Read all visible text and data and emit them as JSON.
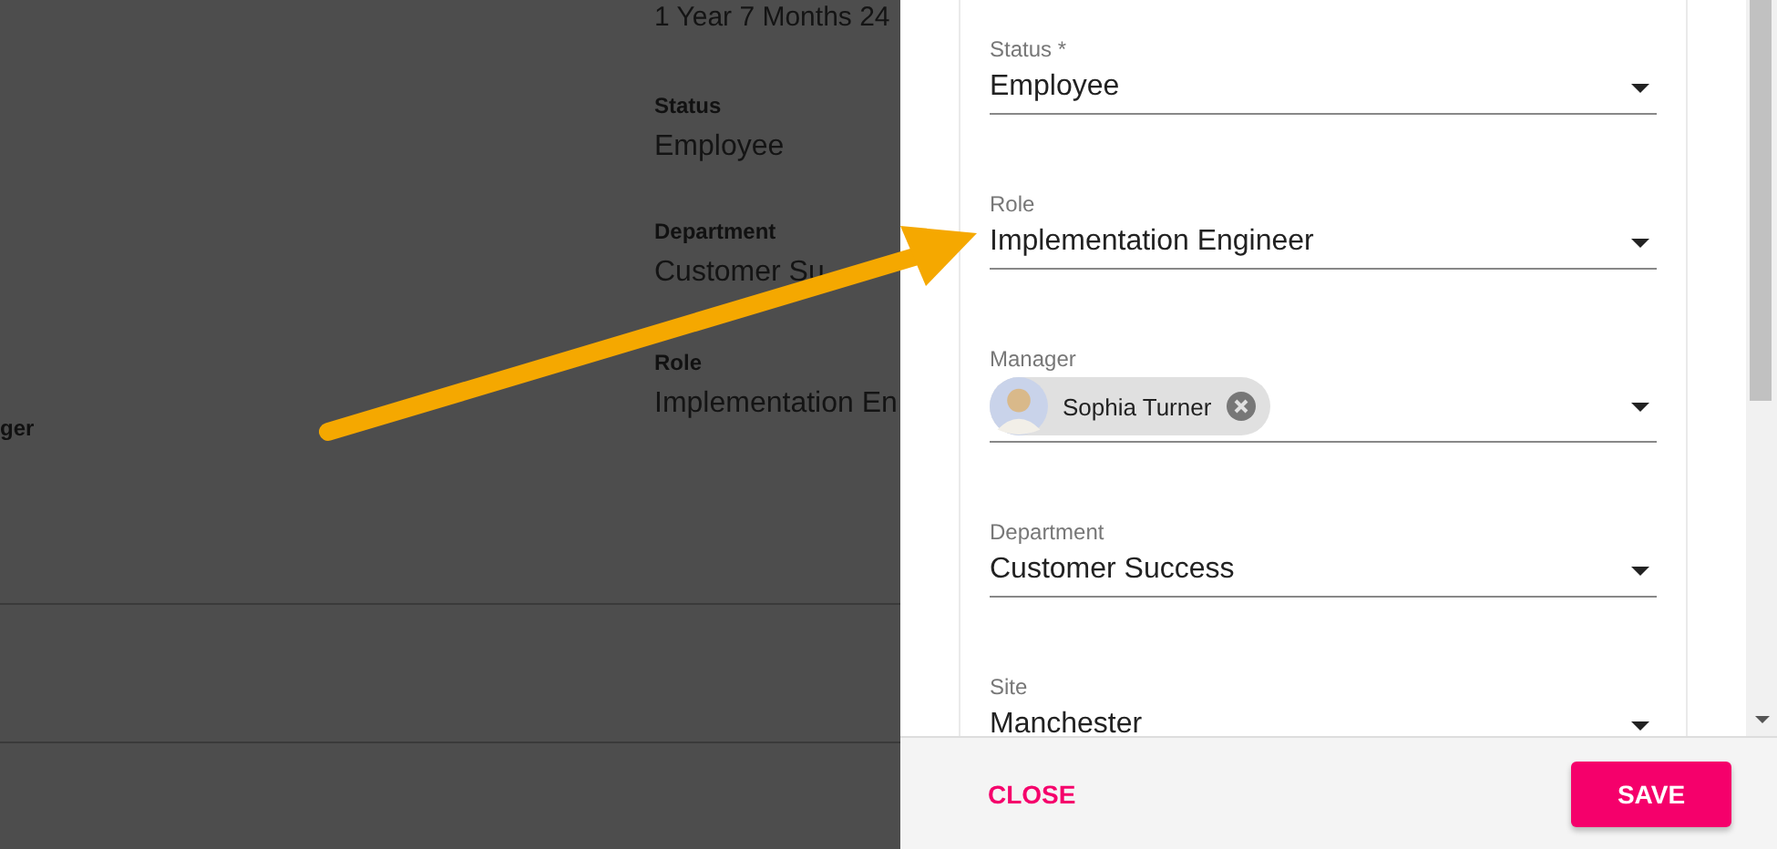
{
  "background_page": {
    "tenure": "1 Year 7 Months 24",
    "fields": [
      {
        "label": "Status",
        "value": "Employee"
      },
      {
        "label": "Department",
        "value": "Customer Su"
      },
      {
        "label": "Role",
        "value": "Implementation En"
      }
    ],
    "side_label": "ger"
  },
  "panel": {
    "fields": [
      {
        "kind": "select",
        "label": "Status *",
        "value": "Employee"
      },
      {
        "kind": "select",
        "label": "Role",
        "value": "Implementation Engineer"
      },
      {
        "kind": "person",
        "label": "Manager",
        "value": "Sophia Turner"
      },
      {
        "kind": "select",
        "label": "Department",
        "value": "Customer Success"
      },
      {
        "kind": "select",
        "label": "Site",
        "value": "Manchester"
      }
    ],
    "close": "CLOSE",
    "save": "SAVE"
  }
}
